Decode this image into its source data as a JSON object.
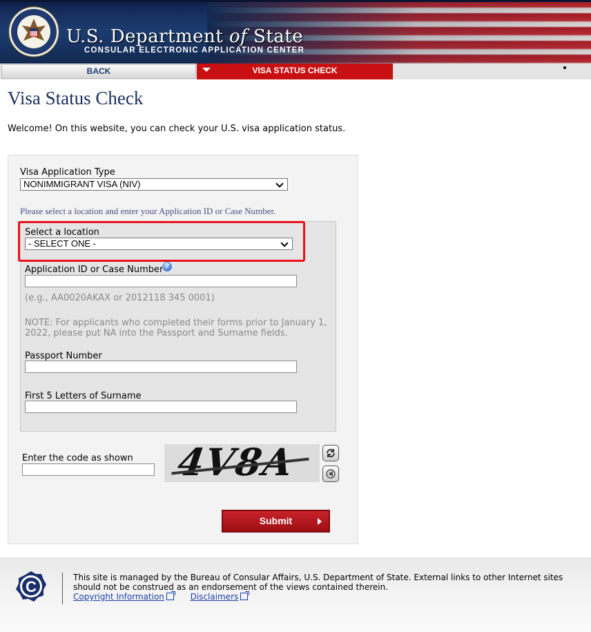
{
  "header": {
    "title_prefix": "U.S. Department ",
    "title_of": "of",
    "title_suffix": " State",
    "subtitle": "CONSULAR ELECTRONIC APPLICATION CENTER"
  },
  "nav": {
    "back_label": "BACK",
    "active_label": "VISA STATUS CHECK"
  },
  "page": {
    "title": "Visa Status Check",
    "welcome": "Welcome! On this website, you can check your U.S. visa application status."
  },
  "form": {
    "app_type_label": "Visa Application Type",
    "app_type_value": "NONIMMIGRANT VISA (NIV)",
    "location_hint": "Please select a location and enter your Application ID or Case Number.",
    "location_label": "Select a location",
    "location_value": "- SELECT ONE -",
    "app_id_label": "Application ID or Case Number",
    "help_glyph": "?",
    "app_id_example": "(e.g., AA0020AKAX or 2012118 345 0001)",
    "note": "NOTE: For applicants who completed their forms prior to January 1, 2022, please put NA into the Passport and Surname fields.",
    "passport_label": "Passport Number",
    "surname_label": "First 5 Letters of Surname",
    "captcha_label": "Enter the code as shown",
    "captcha_code": "4V8A",
    "submit_label": "Submit"
  },
  "footer": {
    "text": "This site is managed by the Bureau of Consular Affairs, U.S. Department of State. External links to other Internet sites should not be construed as an endorsement of the views contained therein.",
    "copyright_link": "Copyright Information",
    "disclaimers_link": "Disclaimers",
    "logo_letter": "C"
  },
  "icons": {
    "refresh": "refresh-icon",
    "audio": "audio-icon",
    "help": "help-icon",
    "external": "external-link-icon"
  },
  "colors": {
    "nav_active": "#c80f12",
    "title": "#1b2f5e",
    "highlight": "#e8111a",
    "submit": "#b0161c",
    "link": "#1a3ea8"
  }
}
